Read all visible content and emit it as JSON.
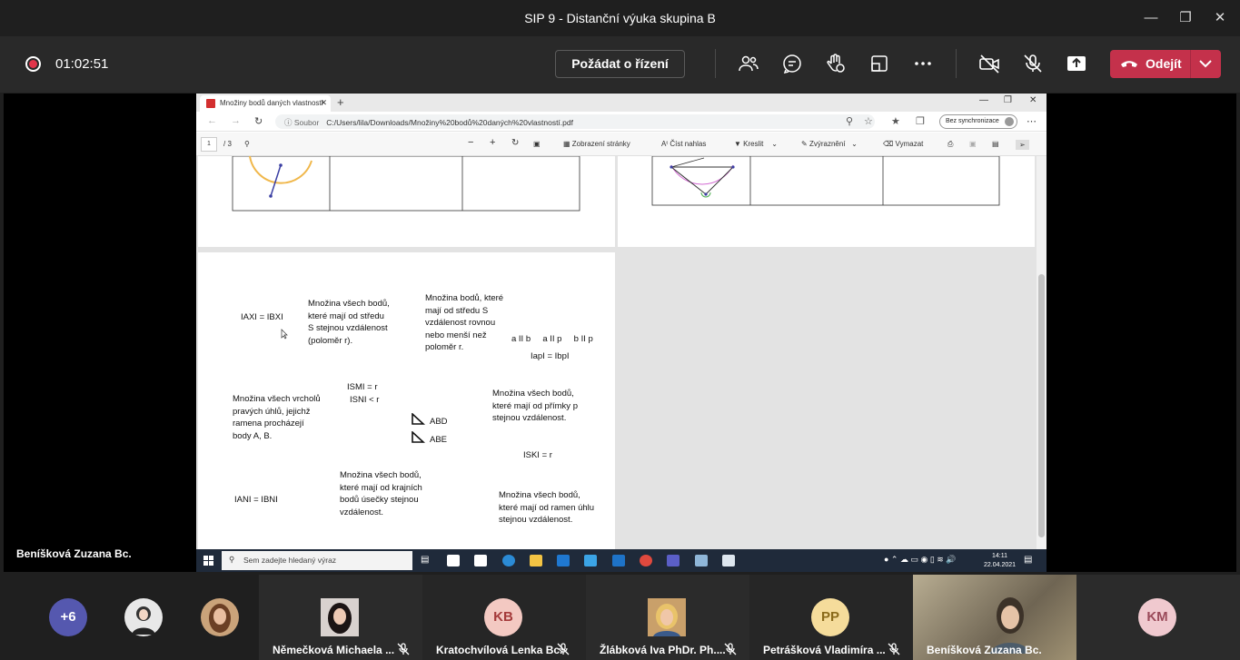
{
  "window": {
    "title": "SIP 9 - Distanční výuka skupina B"
  },
  "toolbar": {
    "timer": "01:02:51",
    "request_control": "Požádat o řízení",
    "leave": "Odejít"
  },
  "presenter": {
    "name": "Beníšková Zuzana Bc."
  },
  "browser": {
    "tab_title": "Množiny bodů daných vlastností",
    "address_label": "Soubor",
    "url": "C:/Users/lila/Downloads/Množiny%20bodů%20daných%20vlastností.pdf",
    "sync_label": "Bez synchronizace",
    "pdf_toolbar": {
      "page_current": "1",
      "page_total": "/ 3",
      "view": "Zobrazení stránky",
      "read_aloud": "Číst nahlas",
      "draw": "Kreslit",
      "highlight": "Zvýraznění",
      "erase": "Vymazat"
    }
  },
  "pdf_page": {
    "texts": [
      {
        "id": "t1",
        "text": "IAXI = IBXI"
      },
      {
        "id": "t2",
        "text": "Množina všech bodů,\nkteré mají od středu\nS stejnou vzdálenost\n(poloměr r)."
      },
      {
        "id": "t3",
        "text": "Množina bodů, které\nmají od středu S\nvzdálenost rovnou\nnebo menší než\npoloměr r."
      },
      {
        "id": "t4",
        "text": "a II b     a II p     b II p"
      },
      {
        "id": "t5",
        "text": "IapI = IbpI"
      },
      {
        "id": "t6",
        "text": "ISMI = r"
      },
      {
        "id": "t7",
        "text": "ISNI < r"
      },
      {
        "id": "t8",
        "text": "Množina všech vrcholů\npravých úhlů, jejichž\nramena procházejí\nbody A, B."
      },
      {
        "id": "t9",
        "text": "ABD"
      },
      {
        "id": "t10",
        "text": "ABE"
      },
      {
        "id": "t11",
        "text": "Množina všech bodů,\nkteré mají od přímky p\nstejnou vzdálenost."
      },
      {
        "id": "t12",
        "text": "ISKI = r"
      },
      {
        "id": "t13",
        "text": "IANI = IBNI"
      },
      {
        "id": "t14",
        "text": "Množina všech bodů,\nkteré mají od krajních\nbodů úsečky stejnou\nvzdálenost."
      },
      {
        "id": "t15",
        "text": "Množina všech bodů,\nkteré mají od ramen úhlu\nstejnou vzdálenost."
      }
    ]
  },
  "taskbar": {
    "search_placeholder": "Sem zadejte hledaný výraz",
    "time": "14:11",
    "date": "22.04.2021"
  },
  "participants": [
    {
      "initials": "+6",
      "name": "",
      "color": "#5558af"
    },
    {
      "initials": "",
      "name": "",
      "color": "#e8e8e8"
    },
    {
      "initials": "",
      "name": "",
      "color": "#caa37a"
    },
    {
      "initials": "",
      "name": "Němečková Michaela ...",
      "color": "#3a3030"
    },
    {
      "initials": "KB",
      "name": "Kratochvílová Lenka Bc.",
      "color": "#f3c9c2"
    },
    {
      "initials": "",
      "name": "Žlábková Iva PhDr. Ph....",
      "color": "#d8b06a"
    },
    {
      "initials": "PP",
      "name": "Petrášková Vladimíra ...",
      "color": "#f5dc9b"
    },
    {
      "initials": "",
      "name": "Beníšková Zuzana Bc.",
      "color": "#8a7f6a"
    },
    {
      "initials": "KM",
      "name": "",
      "color": "#f0c9cf"
    }
  ]
}
